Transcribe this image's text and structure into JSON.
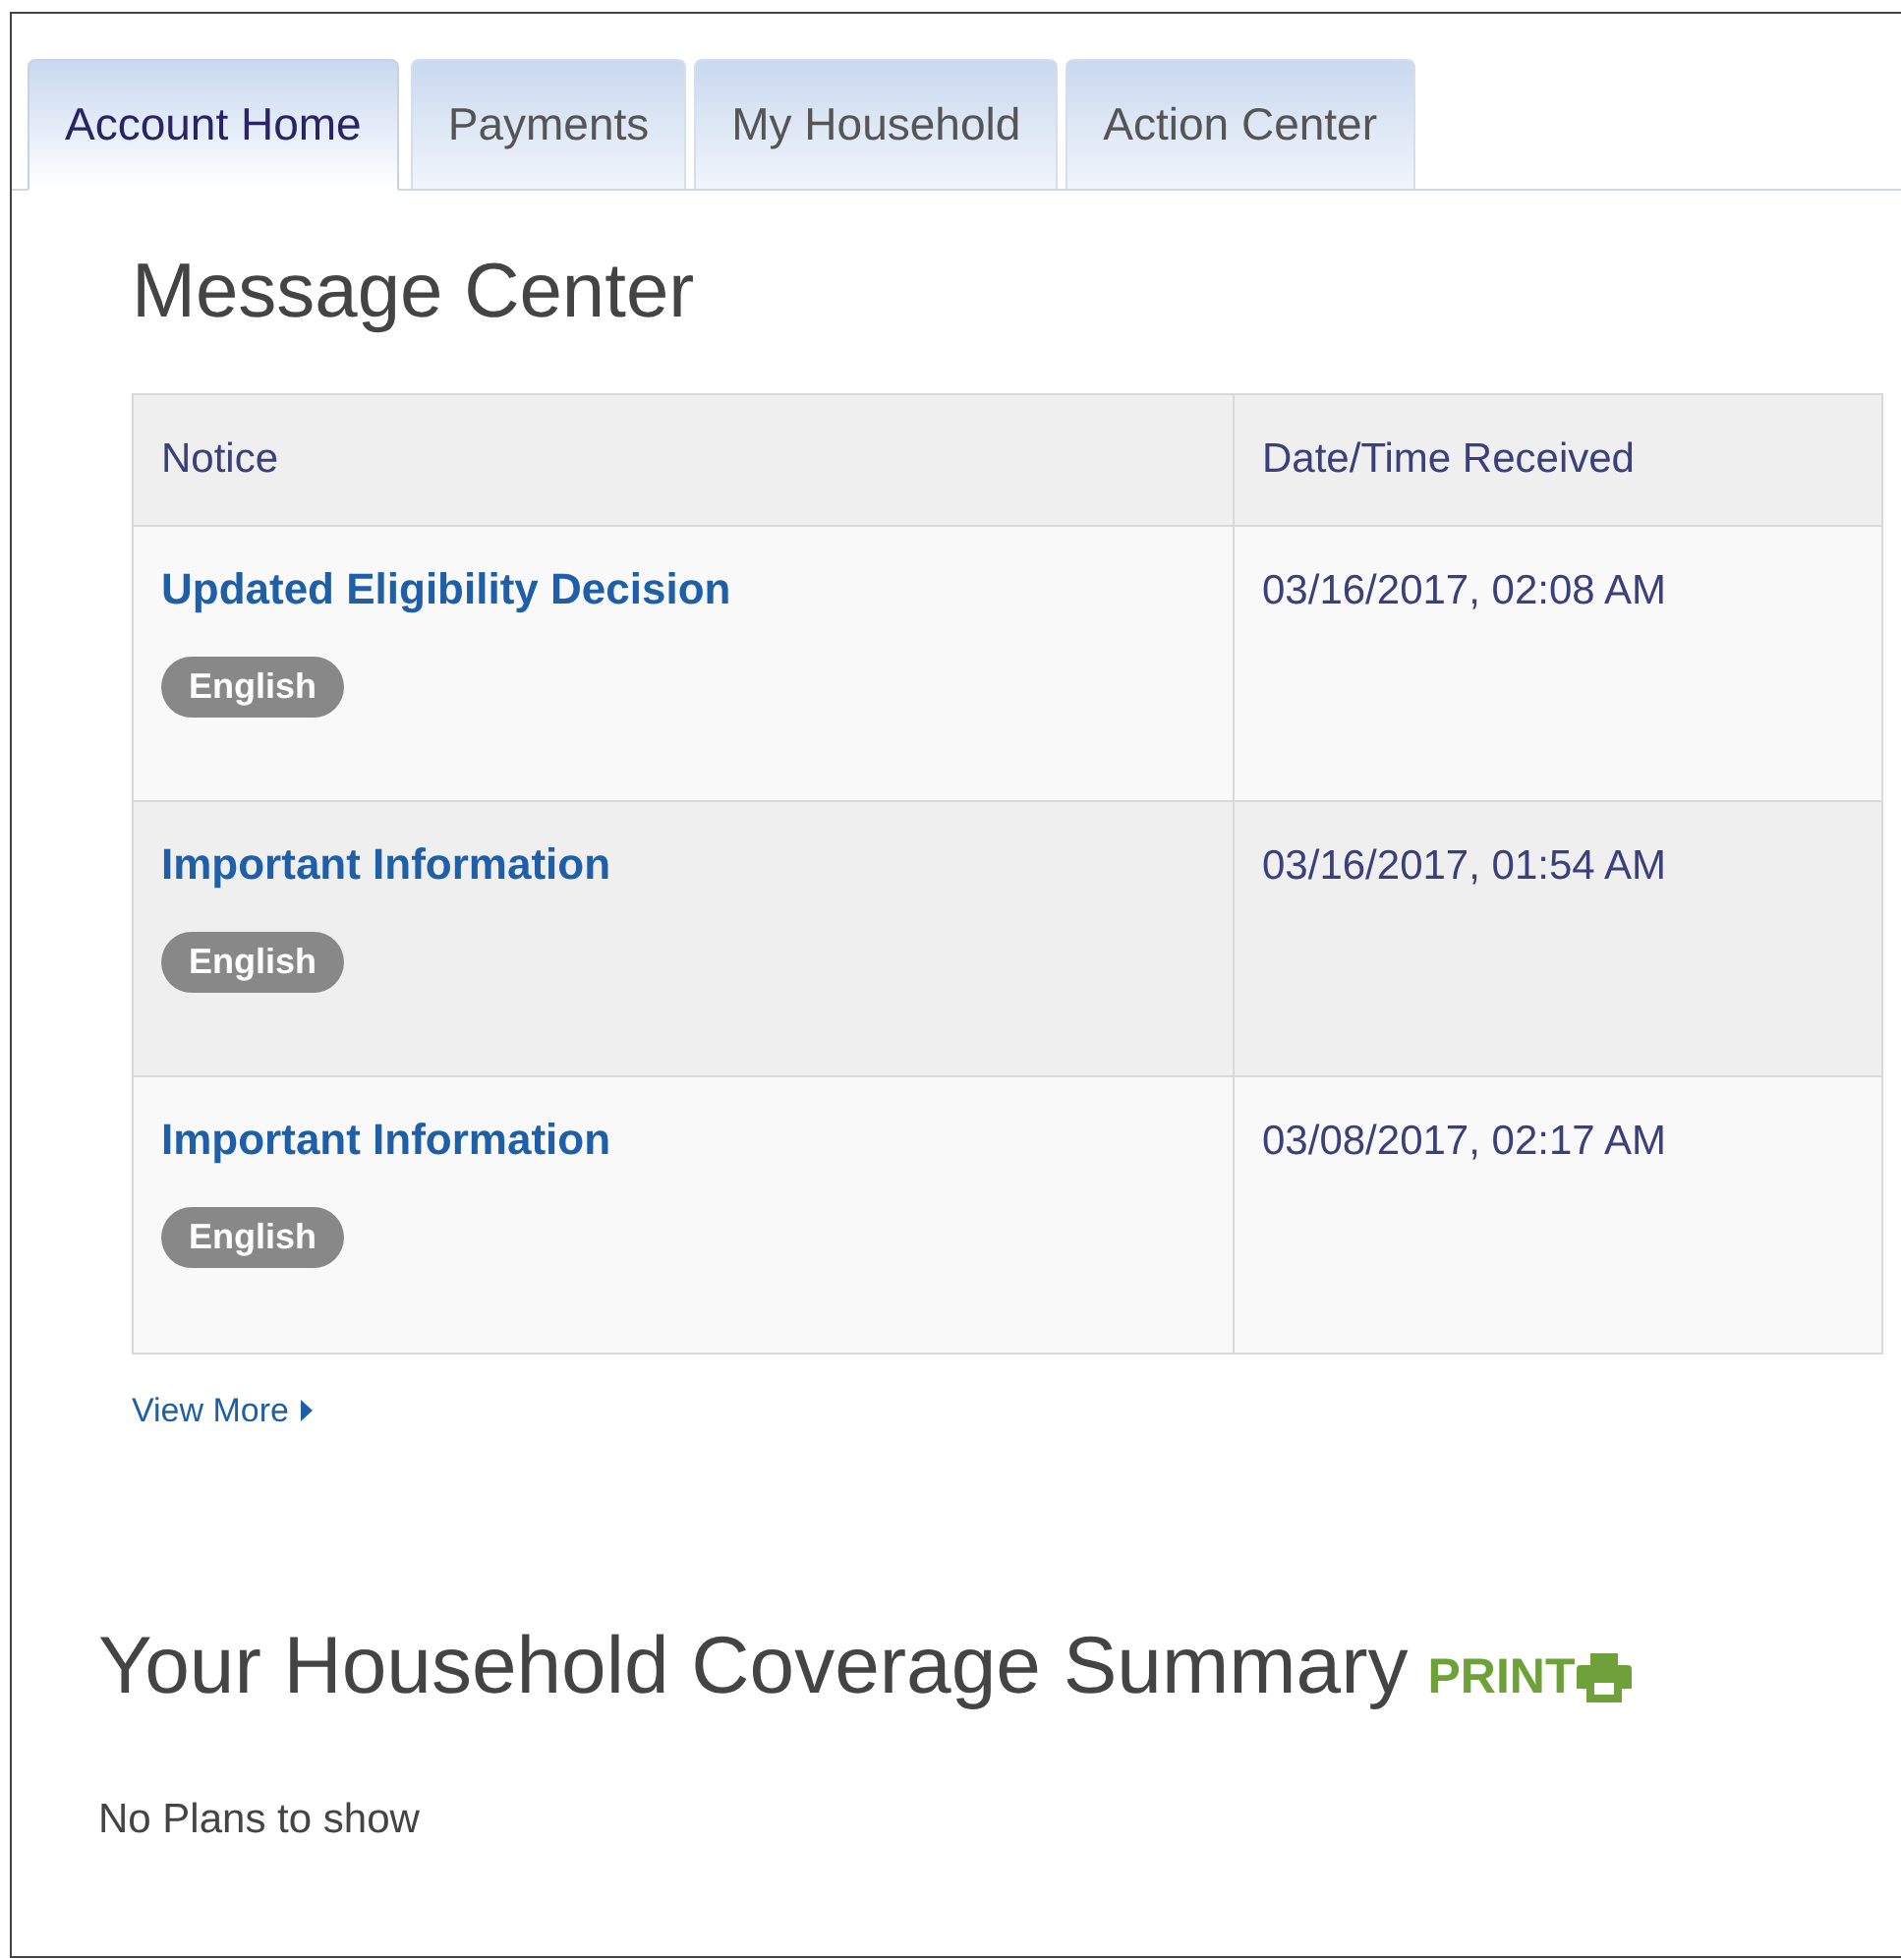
{
  "tabs": [
    {
      "label": "Account Home",
      "selected": true
    },
    {
      "label": "Payments",
      "selected": false
    },
    {
      "label": "My Household",
      "selected": false
    },
    {
      "label": "Action Center",
      "selected": false
    }
  ],
  "message_center": {
    "title": "Message Center",
    "columns": [
      "Notice",
      "Date/Time Received"
    ],
    "rows": [
      {
        "notice": "Updated Eligibility Decision",
        "language": "English",
        "received": "03/16/2017, 02:08 AM"
      },
      {
        "notice": "Important Information",
        "language": "English",
        "received": "03/16/2017, 01:54 AM"
      },
      {
        "notice": "Important Information",
        "language": "English",
        "received": "03/08/2017, 02:17 AM"
      }
    ],
    "view_more": "View More"
  },
  "coverage_summary": {
    "title": "Your Household Coverage Summary",
    "print": "PRINT",
    "empty_text": "No Plans to show"
  }
}
